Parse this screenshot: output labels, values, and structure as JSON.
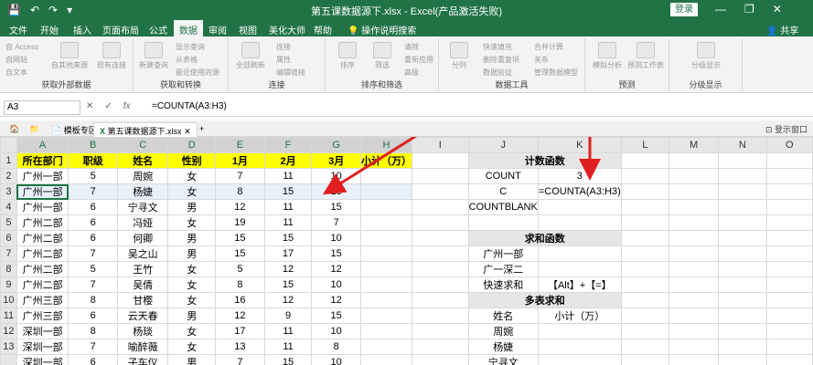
{
  "titlebar": {
    "title": "第五课数据源下.xlsx  -  Excel(产品激活失败)",
    "login": "登录",
    "minimize": "—",
    "restore": "❐",
    "close": "✕",
    "save": "💾",
    "undo": "↶",
    "redo": "↷",
    "more": "▾"
  },
  "menu": {
    "items": [
      "文件",
      "开始",
      "插入",
      "页面布局",
      "公式",
      "数据",
      "审阅",
      "视图",
      "美化大师",
      "帮助",
      "操作说明搜索"
    ],
    "share": "共享"
  },
  "ribbon": {
    "groups": [
      "获取外部数据",
      "获取和转换",
      "连接",
      "排序和筛选",
      "数据工具",
      "预测",
      "分级显示"
    ],
    "access": "自 Access",
    "website": "自网站",
    "text": "自文本",
    "other": "自其他来源",
    "existing": "现有连接",
    "new_query": "新建查询",
    "show_query": "显示查询",
    "from_table": "从表格",
    "recent": "最近使用的源",
    "refresh_all": "全部刷新",
    "connections": "连接",
    "properties": "属性",
    "edit_links": "编辑链接",
    "sort": "排序",
    "filter": "筛选",
    "clear": "清除",
    "reapply": "重新应用",
    "advanced": "高级",
    "split": "分列",
    "flash_fill": "快速填充",
    "remove_dup": "删除重复项",
    "validation": "数据验证",
    "consolidate": "合并计算",
    "relationships": "关系",
    "manage_model": "管理数据模型",
    "whatif": "模拟分析",
    "forecast": "预测工作表",
    "group": "分级显示"
  },
  "formula_bar": {
    "name_box": "A3",
    "formula": "=COUNTA(A3:H3)"
  },
  "tabs": {
    "templates": "模板专区",
    "file": "第五课数据源下.xlsx",
    "add": "+",
    "restore": "登示窗口"
  },
  "columns": [
    "A",
    "B",
    "C",
    "D",
    "E",
    "F",
    "G",
    "H",
    "I",
    "J",
    "K",
    "L",
    "M",
    "N",
    "O"
  ],
  "rows": [
    "1",
    "2",
    "3",
    "4",
    "5",
    "6",
    "7",
    "8",
    "9",
    "10",
    "11",
    "12",
    "13"
  ],
  "header": [
    "所在部门",
    "职级",
    "姓名",
    "性别",
    "1月",
    "2月",
    "3月",
    "小计（万）"
  ],
  "data": [
    [
      "广州一部",
      "5",
      "周婉",
      "女",
      "7",
      "11",
      "10",
      ""
    ],
    [
      "广州一部",
      "7",
      "杨婕",
      "女",
      "8",
      "15",
      "15",
      ""
    ],
    [
      "广州一部",
      "6",
      "宁寻文",
      "男",
      "12",
      "11",
      "15",
      ""
    ],
    [
      "广州二部",
      "6",
      "冯娅",
      "女",
      "19",
      "11",
      "7",
      ""
    ],
    [
      "广州二部",
      "6",
      "何卿",
      "男",
      "15",
      "15",
      "10",
      ""
    ],
    [
      "广州二部",
      "7",
      "吴之山",
      "男",
      "15",
      "17",
      "15",
      ""
    ],
    [
      "广州二部",
      "5",
      "王竹",
      "女",
      "5",
      "12",
      "12",
      ""
    ],
    [
      "广州二部",
      "7",
      "吴倩",
      "女",
      "8",
      "15",
      "10",
      ""
    ],
    [
      "广州三部",
      "8",
      "甘樱",
      "女",
      "16",
      "12",
      "12",
      ""
    ],
    [
      "广州三部",
      "6",
      "云天春",
      "男",
      "12",
      "9",
      "15",
      ""
    ],
    [
      "深圳一部",
      "8",
      "杨琰",
      "女",
      "17",
      "11",
      "10",
      ""
    ],
    [
      "深圳一部",
      "7",
      "喻醉薇",
      "女",
      "13",
      "11",
      "8",
      ""
    ]
  ],
  "side": {
    "count_title": "计数函数",
    "count_label": "COUNT",
    "count_value": "3",
    "counta_label": "C",
    "counta_formula": "=COUNTA(A3:H3)",
    "countblank_label": "COUNTBLANK",
    "sum_title": "求和函数",
    "gz1": "广州一部",
    "gs": "广一深二",
    "quick_sum": "快速求和",
    "quick_sum_keys": "【Alt】+【=】",
    "multi_title": "多表求和",
    "name_label": "姓名",
    "subtotal_label": "小计（万）",
    "n1": "周婉",
    "n2": "杨婕",
    "n3": "宁寻文"
  },
  "partial_row13": [
    "深圳一部",
    "6",
    "子车仪",
    "男",
    "7",
    "15",
    "10",
    ""
  ],
  "colors": {
    "excel_green": "#217346",
    "header_yellow": "#ffff00",
    "arrow_red": "#e02020"
  }
}
